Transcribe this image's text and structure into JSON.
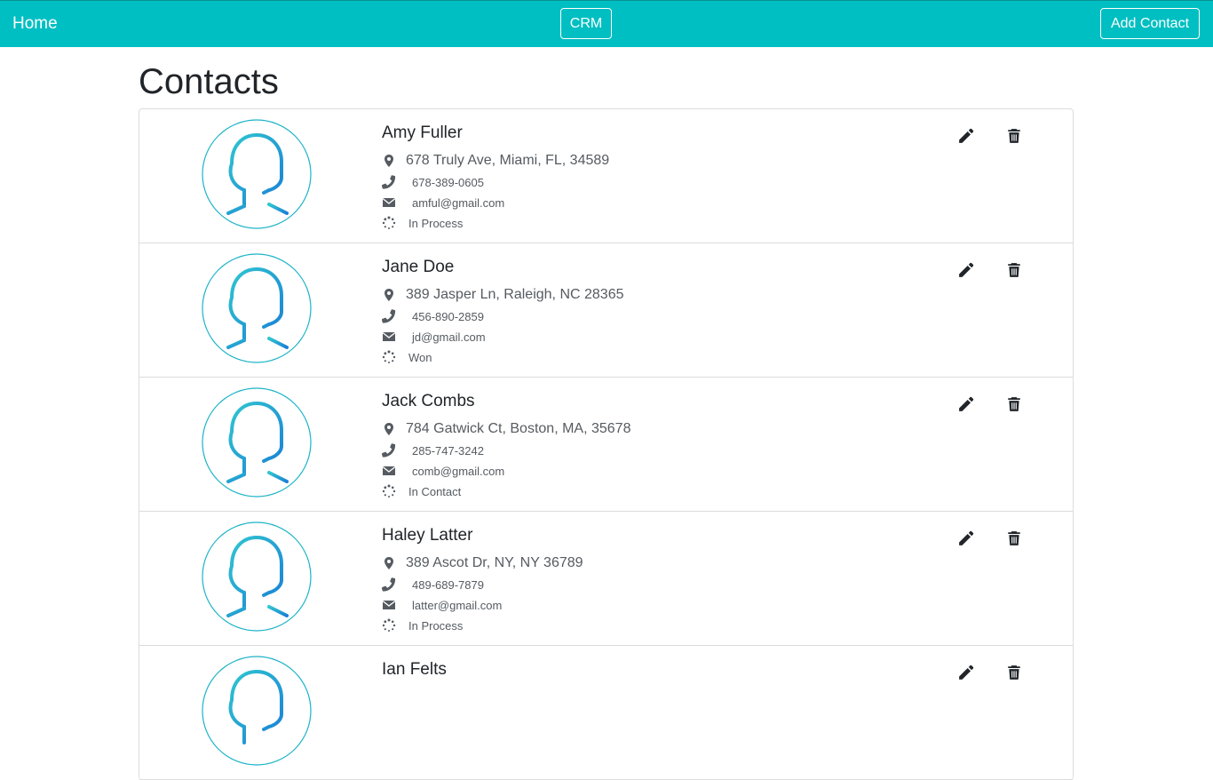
{
  "nav": {
    "home_label": "Home",
    "center_label": "CRM",
    "add_label": "Add Contact"
  },
  "page": {
    "title": "Contacts"
  },
  "colors": {
    "nav_bg": "#00bfc2",
    "avatar_stroke": "#1ab3c7"
  },
  "contacts": [
    {
      "name": "Amy Fuller",
      "address": "678 Truly Ave, Miami, FL, 34589",
      "phone": "678-389-0605",
      "email": "amful@gmail.com",
      "status": "In Process"
    },
    {
      "name": "Jane Doe",
      "address": "389 Jasper Ln, Raleigh, NC 28365",
      "phone": "456-890-2859",
      "email": "jd@gmail.com",
      "status": "Won"
    },
    {
      "name": "Jack Combs",
      "address": "784 Gatwick Ct, Boston, MA, 35678",
      "phone": "285-747-3242",
      "email": "comb@gmail.com",
      "status": "In Contact"
    },
    {
      "name": "Haley Latter",
      "address": "389 Ascot Dr, NY, NY 36789",
      "phone": "489-689-7879",
      "email": "latter@gmail.com",
      "status": "In Process"
    },
    {
      "name": "Ian Felts",
      "address": "",
      "phone": "",
      "email": "",
      "status": ""
    }
  ]
}
